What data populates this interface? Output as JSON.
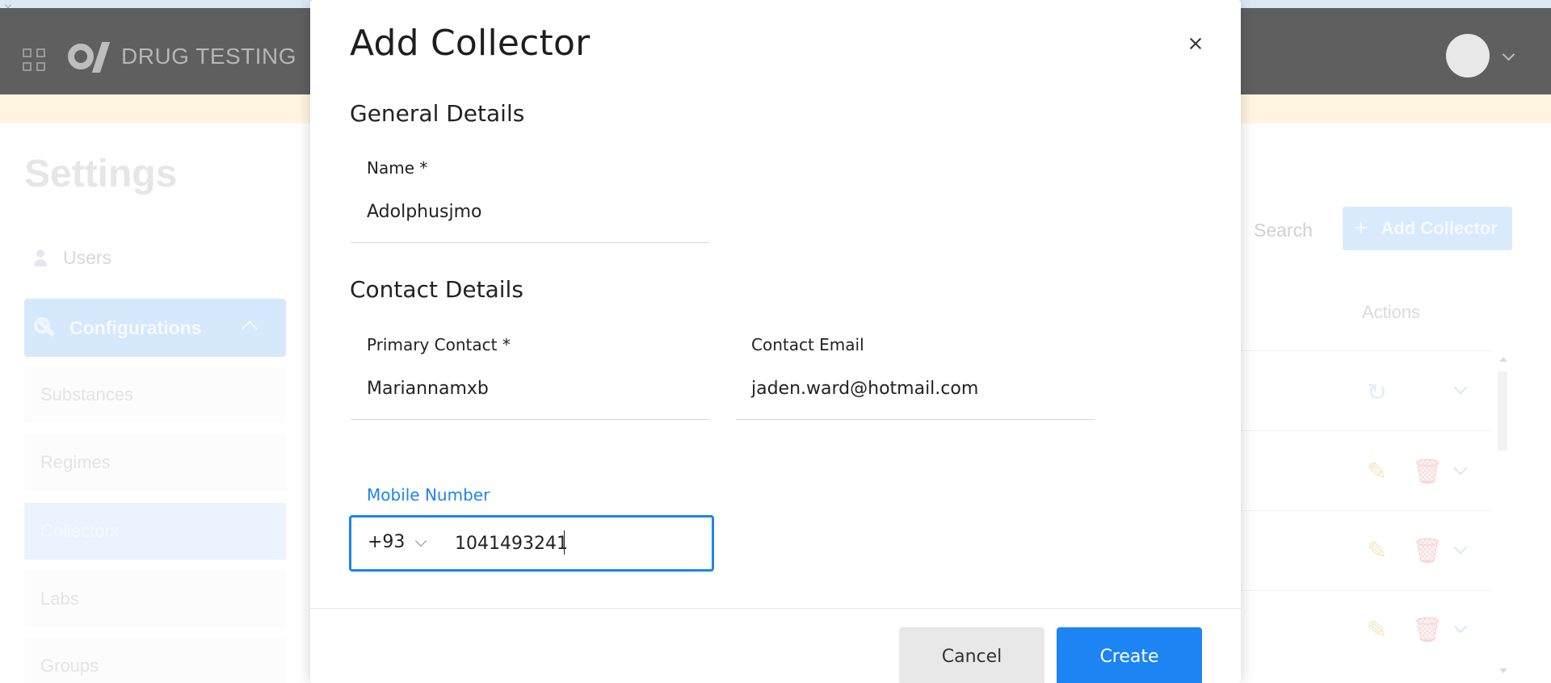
{
  "app": {
    "brand_name": "DRUG TESTING",
    "page_title": "Settings"
  },
  "sidebar": {
    "users_label": "Users",
    "configurations_label": "Configurations",
    "items": [
      {
        "label": "Substances",
        "active": false
      },
      {
        "label": "Regimes",
        "active": false
      },
      {
        "label": "Collectors",
        "active": true
      },
      {
        "label": "Labs",
        "active": false
      },
      {
        "label": "Groups",
        "active": false
      }
    ]
  },
  "background_toolbar": {
    "search_label": "Search",
    "add_collector_label": "Add Collector",
    "actions_header": "Actions"
  },
  "modal": {
    "title": "Add Collector",
    "general_heading": "General Details",
    "name": {
      "label": "Name *",
      "value": "Adolphusjmo"
    },
    "contact_heading": "Contact Details",
    "primary_contact": {
      "label": "Primary Contact *",
      "value": "Mariannamxb"
    },
    "contact_email": {
      "label": "Contact Email",
      "value": "jaden.ward@hotmail.com"
    },
    "mobile": {
      "label": "Mobile Number",
      "country_code": "+93",
      "value": "1041493241"
    },
    "cancel_label": "Cancel",
    "create_label": "Create"
  },
  "colors": {
    "accent": "#1c84f3",
    "appbar": "#5f5f5f",
    "banner": "#fff5e1",
    "cancel_bg": "#e8e8e8"
  },
  "icons": [
    "apps-grid-icon",
    "brand-logo",
    "avatar",
    "user-group-icon",
    "wrench-icon",
    "plus-icon",
    "refresh-icon",
    "pencil-icon",
    "trash-icon",
    "chevron-down-icon",
    "close-icon"
  ]
}
